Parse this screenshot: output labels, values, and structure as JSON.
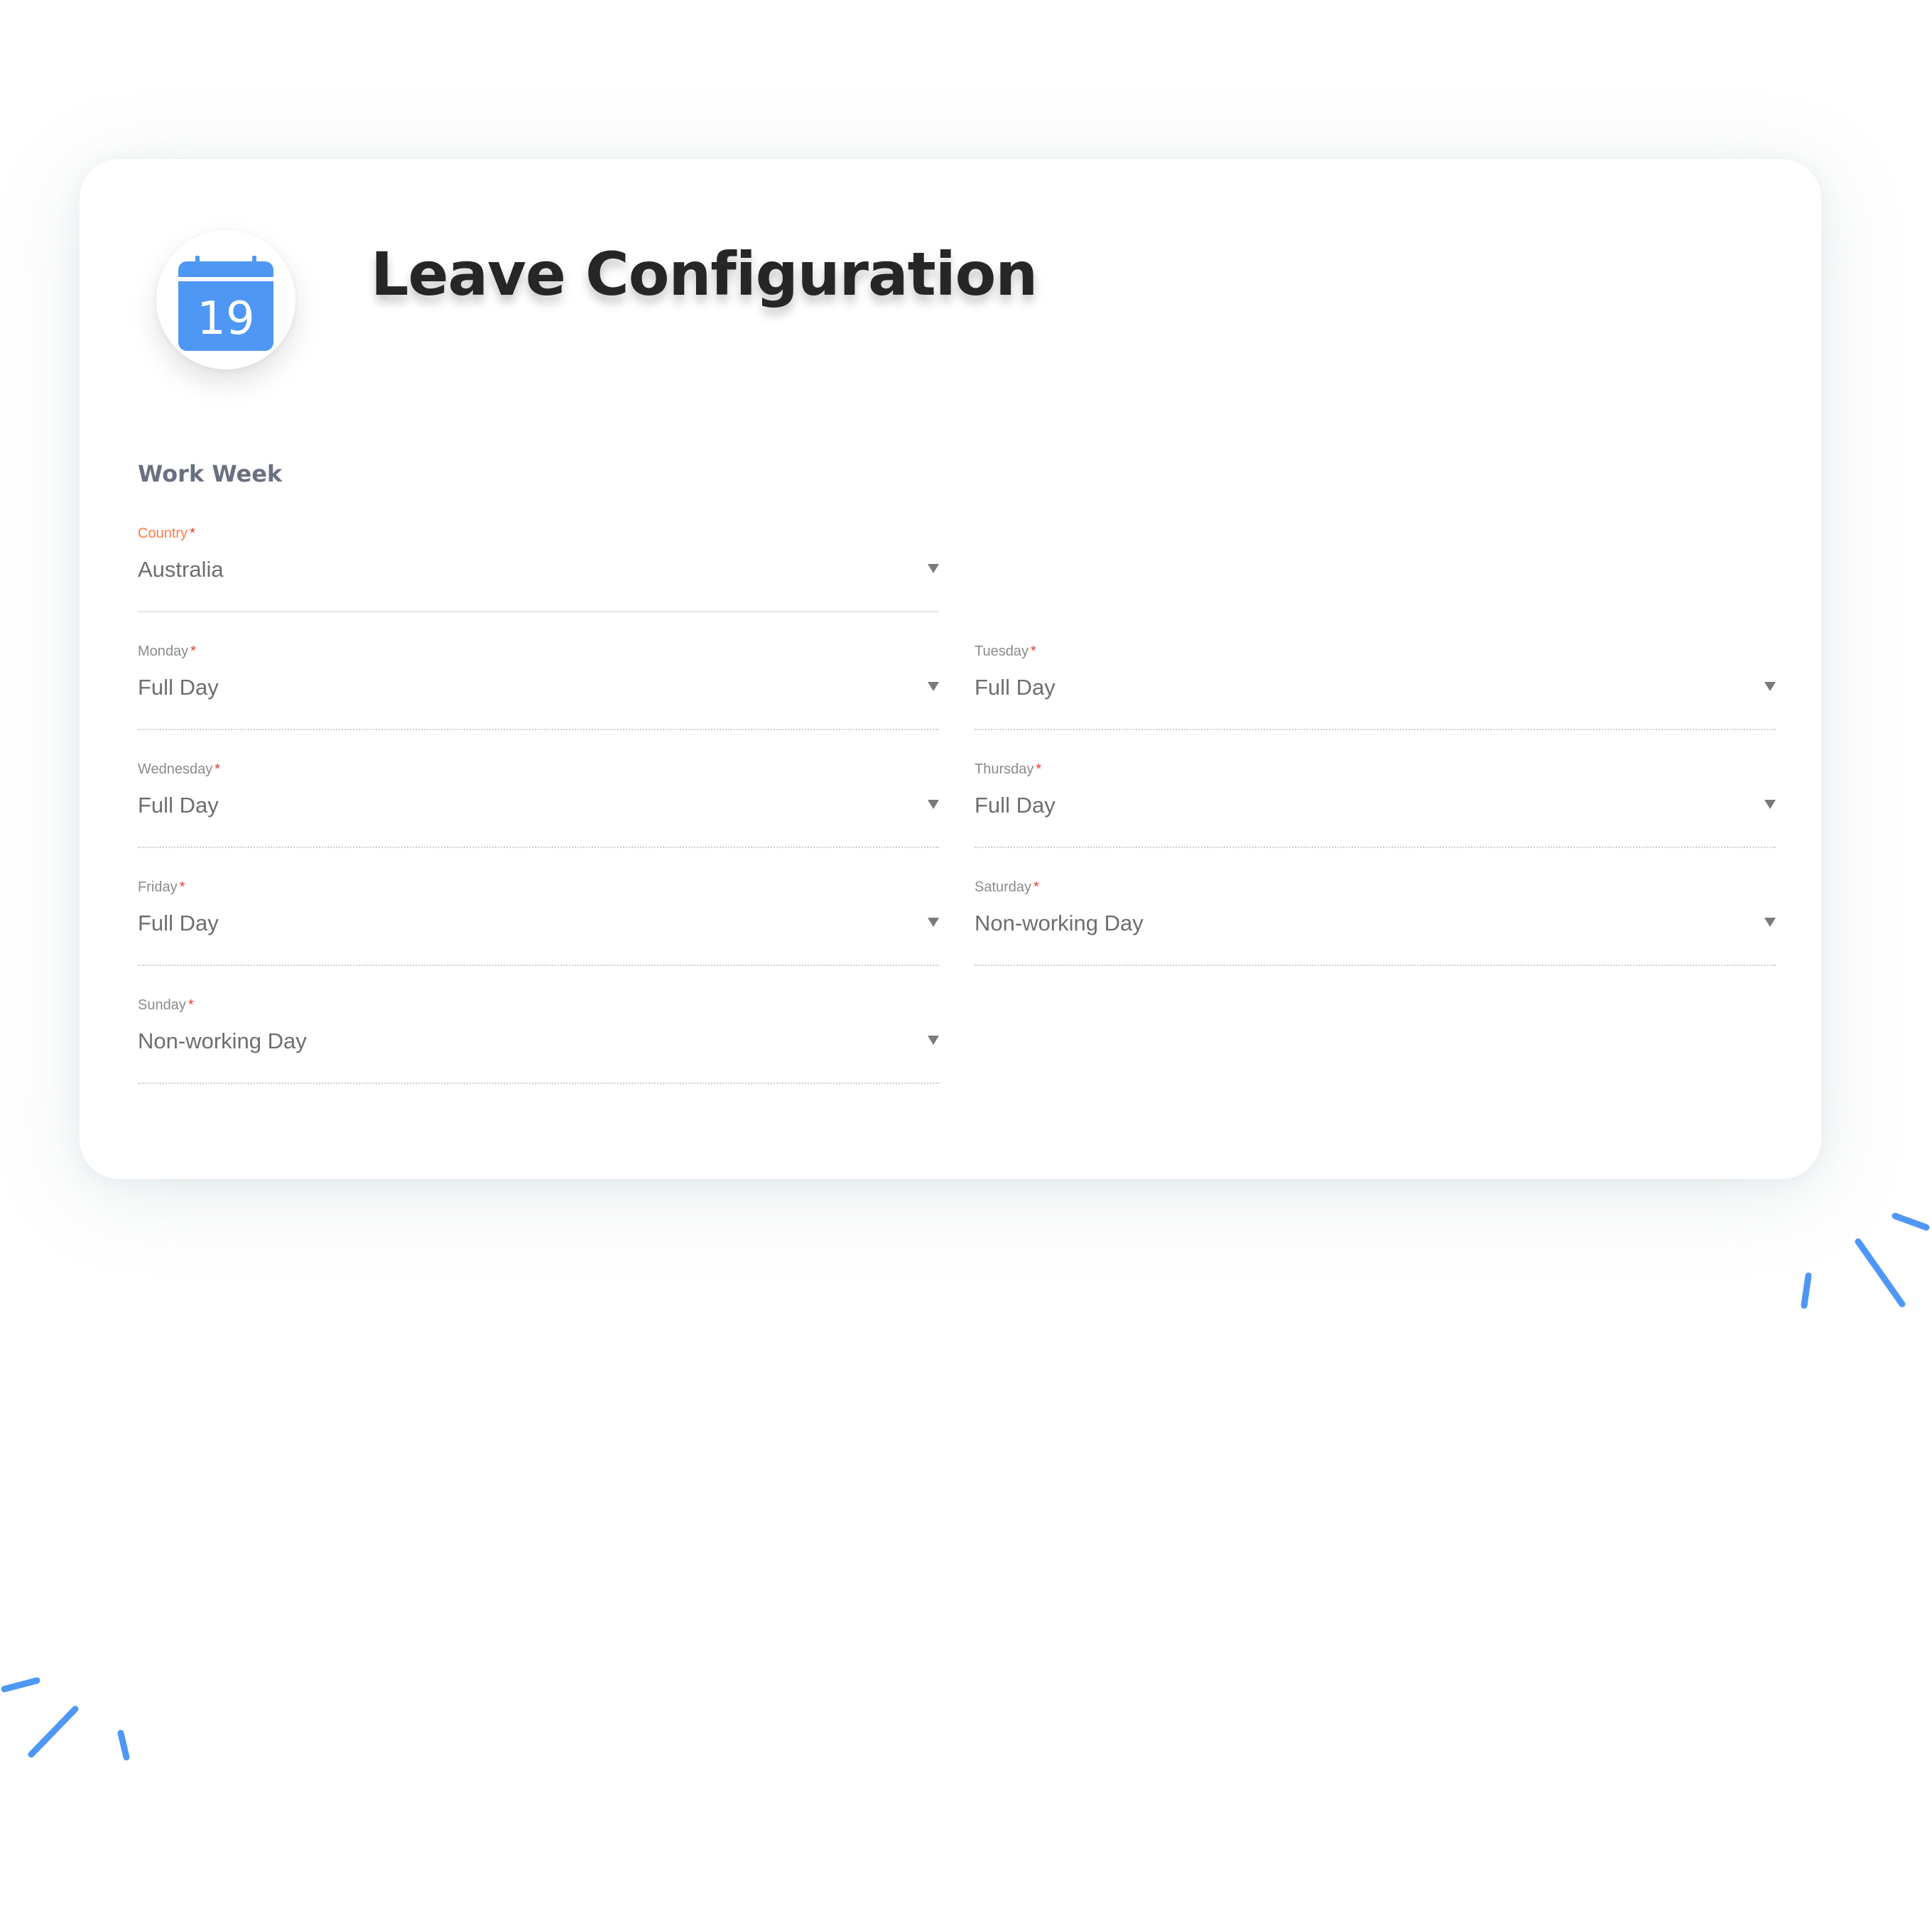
{
  "page": {
    "title": "Leave Configuration"
  },
  "icon": {
    "name": "calendar-icon",
    "day": "19",
    "color": "#4f97f5"
  },
  "section": {
    "title": "Work Week"
  },
  "required_marker": "*",
  "fields": {
    "country": {
      "label": "Country",
      "value": "Australia"
    },
    "monday": {
      "label": "Monday",
      "value": "Full Day"
    },
    "tuesday": {
      "label": "Tuesday",
      "value": "Full Day"
    },
    "wednesday": {
      "label": "Wednesday",
      "value": "Full Day"
    },
    "thursday": {
      "label": "Thursday",
      "value": "Full Day"
    },
    "friday": {
      "label": "Friday",
      "value": "Full Day"
    },
    "saturday": {
      "label": "Saturday",
      "value": "Non-working Day"
    },
    "sunday": {
      "label": "Sunday",
      "value": "Non-working Day"
    }
  },
  "colors": {
    "accent_label": "#ff7a45",
    "required": "#e53935",
    "decoration": "#4f97f5"
  }
}
